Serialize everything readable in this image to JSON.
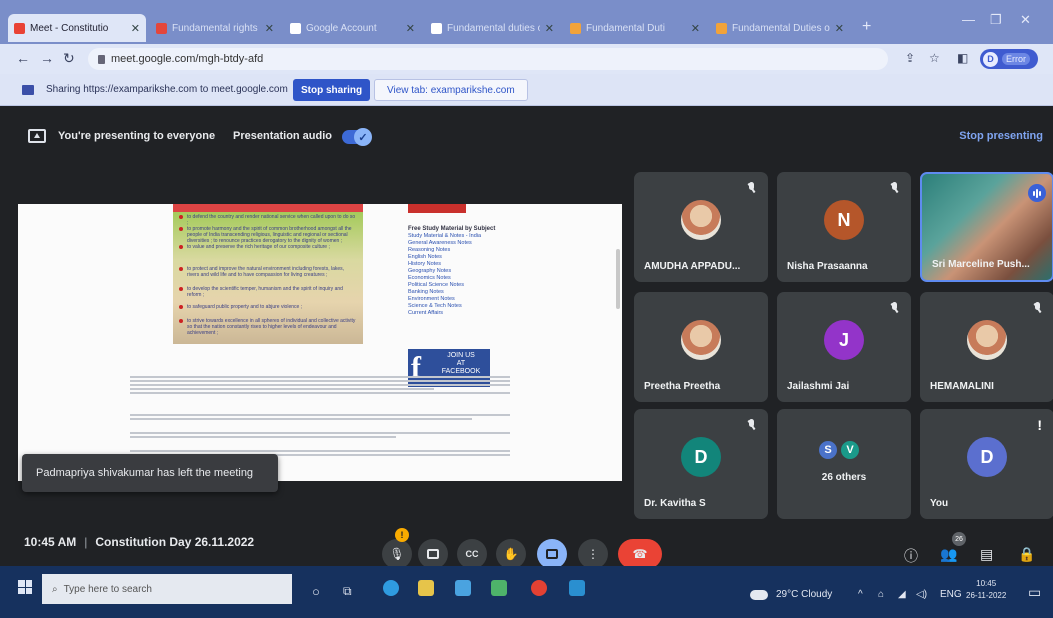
{
  "browser": {
    "tabs": [
      {
        "label": "Meet - Constitutio",
        "active": true,
        "favicon_color": "#e94235"
      },
      {
        "label": "Fundamental rights of",
        "active": false,
        "favicon_color": "#e4463b"
      },
      {
        "label": "Google Account",
        "active": false,
        "favicon_color": "#ffffff"
      },
      {
        "label": "Fundamental duties of",
        "active": false,
        "favicon_color": "#ffffff"
      },
      {
        "label": "Fundamental Duti",
        "active": false,
        "favicon_color": "#f2a33a"
      },
      {
        "label": "Fundamental Duties o",
        "active": false,
        "favicon_color": "#f2a33a"
      }
    ],
    "new_tab": "+",
    "url": "meet.google.com/mgh-btdy-afd",
    "profile_initial": "D",
    "profile_label": "Error"
  },
  "sharing_bar": {
    "text": "Sharing https://examparikshe.com to meet.google.com",
    "stop_sharing": "Stop sharing",
    "view_tab": "View tab: examparikshe.com"
  },
  "meet": {
    "presenting_text": "You're presenting to everyone",
    "presentation_audio": "Presentation audio",
    "presentation_audio_on": true,
    "stop_presenting": "Stop presenting",
    "toast": "Padmapriya shivakumar has left the meeting",
    "time": "10:45 AM",
    "meeting_title": "Constitution Day 26.11.2022",
    "participant_count_badge": "26",
    "shared_content": {
      "sidebar_heading": "Free Study Material by Subject",
      "sidebar_links": [
        "Study Material & Notes - India",
        "General Awareness Notes",
        "Reasoning Notes",
        "English Notes",
        "History Notes",
        "Geography Notes",
        "Economics Notes",
        "Political Science Notes",
        "Banking Notes",
        "Environment Notes",
        "Science & Tech Notes",
        "Current Affairs"
      ],
      "facebook_line1": "JOIN US",
      "facebook_line2": "AT",
      "facebook_line3": "FACEBOOK",
      "duties": [
        "to defend the country and render national service when called upon to do so ;",
        "to promote harmony and the spirit of common brotherhood amongst all the people of India transcending religious, linguistic and regional or sectional diversities ; to renounce practices derogatory to the dignity of women ;",
        "to value and preserve the rich heritage of our composite culture ;",
        "to protect and improve the natural environment including forests, lakes, rivers and wild life and to have compassion for living creatures ;",
        "to develop the scientific temper, humanism and the spirit of inquiry and reform ;",
        "to safeguard public property and to abjure violence ;",
        "to strive towards excellence in all spheres of individual and collective activity so that the nation constantly rises to higher levels of endeavour and achievement ;"
      ]
    },
    "participants": [
      {
        "name": "AMUDHA APPADU...",
        "type": "photo",
        "muted": true
      },
      {
        "name": "Nisha Prasaanna",
        "type": "letter",
        "letter": "N",
        "color": "#b5562a",
        "muted": true
      },
      {
        "name": "Sri Marceline Push...",
        "type": "video",
        "muted": false,
        "speaking": true
      },
      {
        "name": "Preetha Preetha",
        "type": "photo",
        "muted": false
      },
      {
        "name": "Jailashmi Jai",
        "type": "letter",
        "letter": "J",
        "color": "#9334c9",
        "muted": true
      },
      {
        "name": "HEMAMALINI",
        "type": "photo",
        "muted": true
      },
      {
        "name": "Dr. Kavitha S",
        "type": "letter",
        "letter": "D",
        "color": "#12857a",
        "muted": true
      },
      {
        "name": "26 others",
        "type": "group",
        "letters": [
          "S",
          "V"
        ],
        "colors": [
          "#4a72c9",
          "#1a9a8a"
        ]
      },
      {
        "name": "You",
        "type": "letter",
        "letter": "D",
        "color": "#5b6fcf",
        "alert": "!"
      }
    ]
  },
  "taskbar": {
    "search_placeholder": "Type here to search",
    "weather": "29°C  Cloudy",
    "language": "ENG",
    "time": "10:45",
    "date": "26-11-2022"
  }
}
